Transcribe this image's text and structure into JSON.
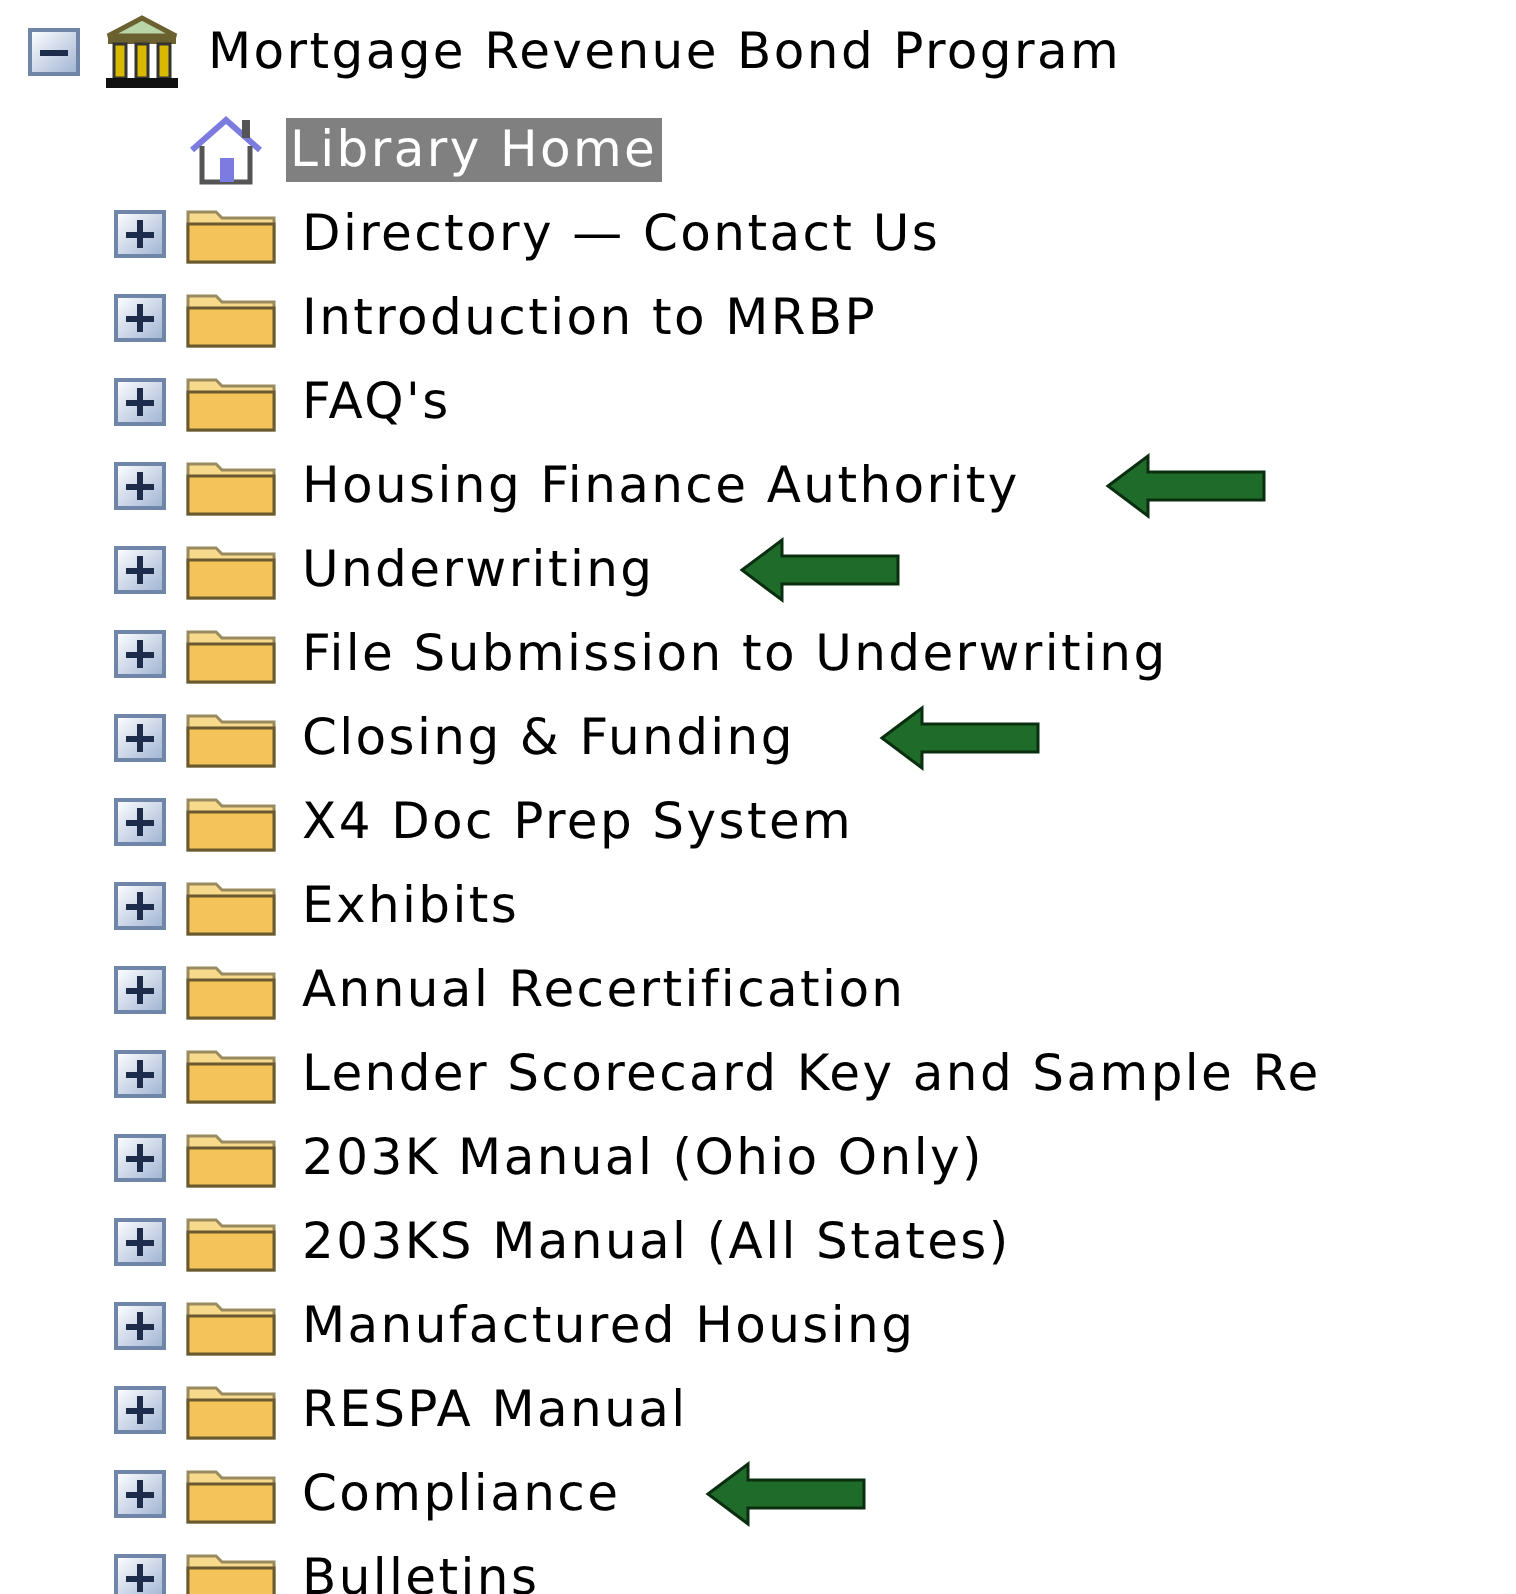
{
  "tree": {
    "label": "Mortgage Revenue Bond Program",
    "expanded": true,
    "selected": false,
    "children": [
      {
        "kind": "home",
        "label": "Library Home",
        "selected": true,
        "arrow": false
      },
      {
        "kind": "folder",
        "label": "Directory — Contact Us",
        "expanded": false,
        "selected": false,
        "arrow": false
      },
      {
        "kind": "folder",
        "label": "Introduction to MRBP",
        "expanded": false,
        "selected": false,
        "arrow": false
      },
      {
        "kind": "folder",
        "label": "FAQ's",
        "expanded": false,
        "selected": false,
        "arrow": false
      },
      {
        "kind": "folder",
        "label": "Housing Finance Authority",
        "expanded": false,
        "selected": false,
        "arrow": true
      },
      {
        "kind": "folder",
        "label": "Underwriting",
        "expanded": false,
        "selected": false,
        "arrow": true
      },
      {
        "kind": "folder",
        "label": "File Submission to Underwriting",
        "expanded": false,
        "selected": false,
        "arrow": false
      },
      {
        "kind": "folder",
        "label": "Closing & Funding",
        "expanded": false,
        "selected": false,
        "arrow": true
      },
      {
        "kind": "folder",
        "label": "X4 Doc Prep System",
        "expanded": false,
        "selected": false,
        "arrow": false
      },
      {
        "kind": "folder",
        "label": "Exhibits",
        "expanded": false,
        "selected": false,
        "arrow": false
      },
      {
        "kind": "folder",
        "label": "Annual Recertification",
        "expanded": false,
        "selected": false,
        "arrow": false
      },
      {
        "kind": "folder",
        "label": "Lender Scorecard Key and Sample Re",
        "expanded": false,
        "selected": false,
        "arrow": false
      },
      {
        "kind": "folder",
        "label": "203K Manual (Ohio Only)",
        "expanded": false,
        "selected": false,
        "arrow": false
      },
      {
        "kind": "folder",
        "label": "203KS Manual (All States)",
        "expanded": false,
        "selected": false,
        "arrow": false
      },
      {
        "kind": "folder",
        "label": "Manufactured Housing",
        "expanded": false,
        "selected": false,
        "arrow": false
      },
      {
        "kind": "folder",
        "label": "RESPA Manual",
        "expanded": false,
        "selected": false,
        "arrow": false
      },
      {
        "kind": "folder",
        "label": "Compliance",
        "expanded": false,
        "selected": false,
        "arrow": true
      },
      {
        "kind": "folder",
        "label": "Bulletins",
        "expanded": false,
        "selected": false,
        "arrow": false
      }
    ]
  }
}
